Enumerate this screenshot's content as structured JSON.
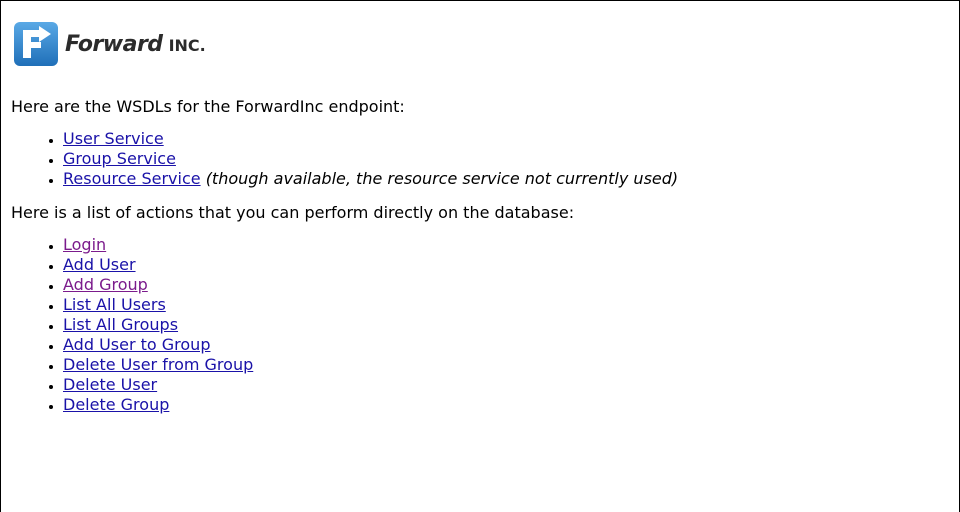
{
  "logo": {
    "brand_name": "Forward",
    "brand_suffix": "INC.",
    "mark_letter": "F",
    "mark_color": "#2f7fc5"
  },
  "wsdl_intro": "Here are the WSDLs for the ForwardInc endpoint:",
  "wsdl_links": [
    {
      "label": "User Service"
    },
    {
      "label": "Group Service"
    },
    {
      "label": "Resource Service",
      "note": "(though available, the resource service not currently used)"
    }
  ],
  "actions_intro": "Here is a list of actions that you can perform directly on the database:",
  "action_links": [
    {
      "label": "Login",
      "visited": true
    },
    {
      "label": "Add User",
      "visited": false
    },
    {
      "label": "Add Group",
      "visited": true
    },
    {
      "label": "List All Users",
      "visited": false
    },
    {
      "label": "List All Groups",
      "visited": false
    },
    {
      "label": "Add User to Group",
      "visited": false
    },
    {
      "label": "Delete User from Group",
      "visited": false
    },
    {
      "label": "Delete User",
      "visited": false
    },
    {
      "label": "Delete Group",
      "visited": false
    }
  ],
  "colors": {
    "link": "#1a12a8",
    "visited_link": "#7b1b8c"
  }
}
